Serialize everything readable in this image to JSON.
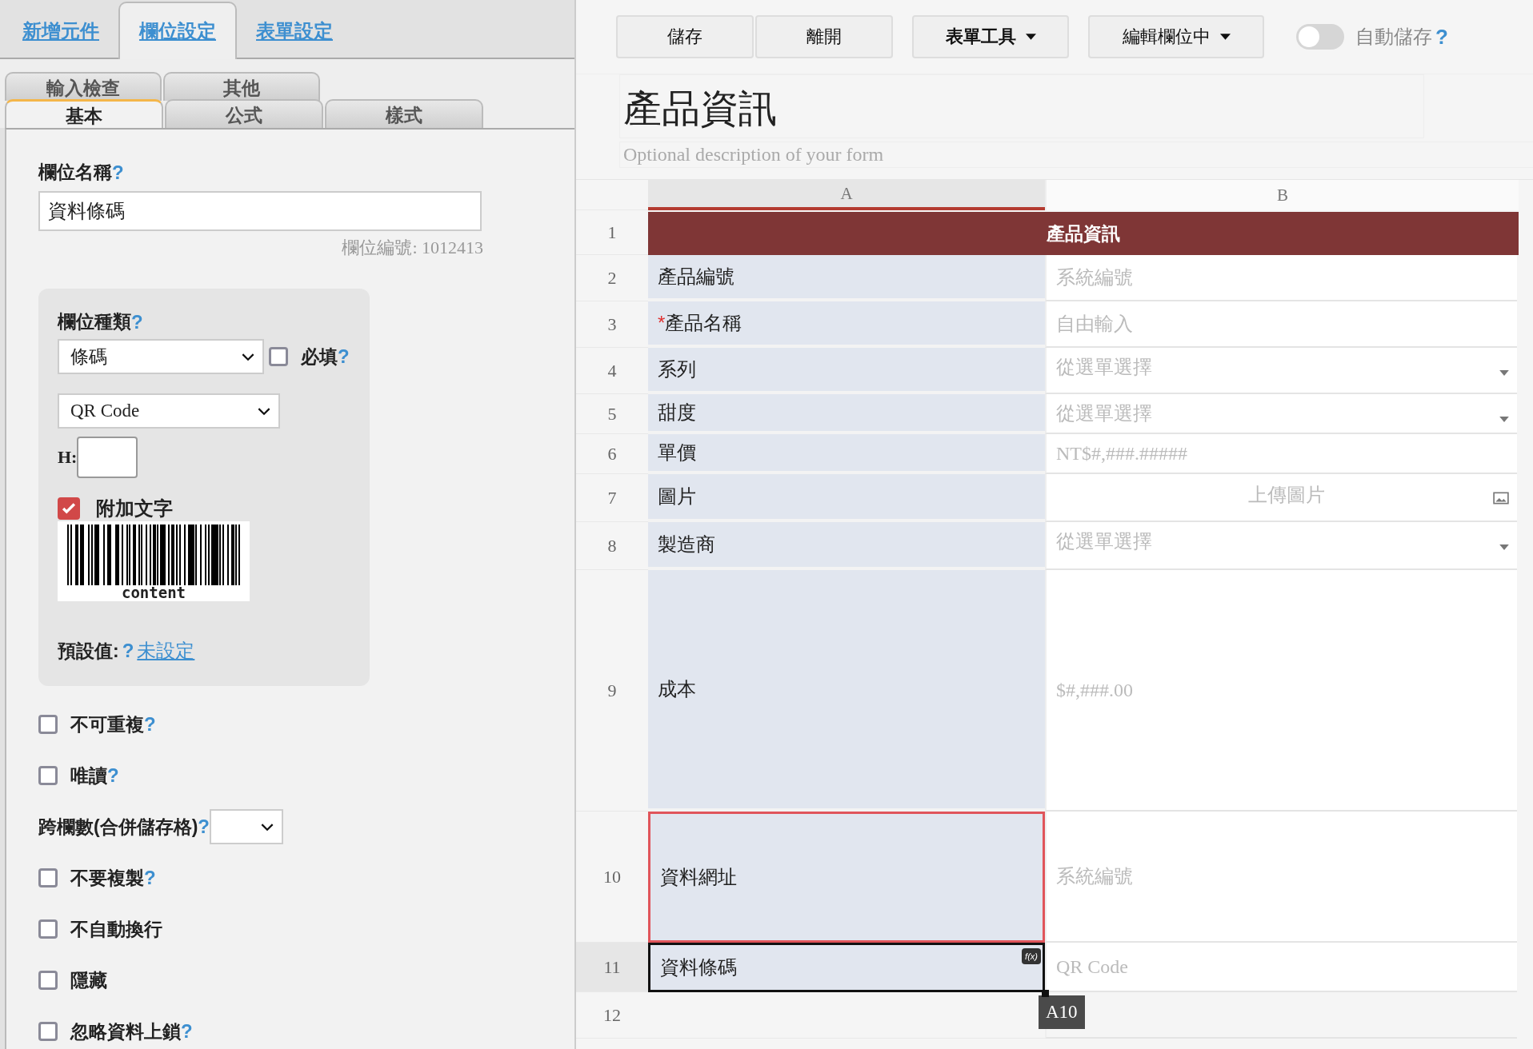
{
  "top_tabs": [
    {
      "label": "新增元件",
      "selected": false
    },
    {
      "label": "欄位設定",
      "selected": true
    },
    {
      "label": "表單設定",
      "selected": false
    }
  ],
  "sub_tabs": [
    [
      {
        "label": "輸入檢查",
        "selected": false
      },
      {
        "label": "其他",
        "selected": false
      }
    ],
    [
      {
        "label": "基本",
        "selected": true
      },
      {
        "label": "公式",
        "selected": false
      },
      {
        "label": "樣式",
        "selected": false
      }
    ]
  ],
  "field_name": {
    "label": "欄位名稱",
    "help": "?",
    "value": "資料條碼",
    "field_id": "欄位編號: 1012413"
  },
  "type_box": {
    "label": "欄位種類",
    "help": "?",
    "type_value": "條碼",
    "required": {
      "label": "必填",
      "help": "?",
      "checked": false
    },
    "subtype_value": "QR Code",
    "h_label": "H:",
    "add_text": {
      "label": "附加文字",
      "checked": true
    },
    "barcode_caption": "content",
    "default_label": "預設值:",
    "default_help": "?",
    "default_link": "未設定"
  },
  "options": [
    {
      "kind": "checkbox",
      "label": "不可重複",
      "help": "?",
      "checked": false
    },
    {
      "kind": "checkbox",
      "label": "唯讀",
      "help": "?",
      "checked": false
    },
    {
      "kind": "select",
      "label": "跨欄數(合併儲存格)",
      "help": "?"
    },
    {
      "kind": "checkbox",
      "label": "不要複製",
      "help": "?",
      "checked": false
    },
    {
      "kind": "checkbox",
      "label": "不自動換行",
      "checked": false
    },
    {
      "kind": "checkbox",
      "label": "隱藏",
      "checked": false
    },
    {
      "kind": "checkbox",
      "label": "忽略資料上鎖",
      "help": "?",
      "checked": false
    }
  ],
  "toolbar": {
    "buttons": [
      {
        "label": "儲存",
        "kind": "plain"
      },
      {
        "label": "離開",
        "kind": "plain"
      },
      {
        "label": "表單工具",
        "kind": "dropdown"
      },
      {
        "label": "編輯欄位中",
        "kind": "dropdown"
      }
    ],
    "autosave": {
      "label": "自動儲存",
      "help": "?",
      "on": false
    }
  },
  "form": {
    "title": "產品資訊",
    "description_placeholder": "Optional description of your form"
  },
  "grid": {
    "columns": [
      {
        "label": "A",
        "selected": true
      },
      {
        "label": "B",
        "selected": false
      }
    ],
    "rows": [
      {
        "num": "1",
        "kind": "header",
        "title": "產品資訊"
      },
      {
        "num": "2",
        "kind": "field",
        "label": "產品編號",
        "hint": {
          "text": "系統編號",
          "kind": "text"
        }
      },
      {
        "num": "3",
        "kind": "field",
        "label": "產品名稱",
        "required_mark": "*",
        "hint": {
          "text": "自由輸入",
          "kind": "text"
        }
      },
      {
        "num": "4",
        "kind": "field",
        "label": "系列",
        "hint": {
          "text": "從選單選擇",
          "kind": "select"
        }
      },
      {
        "num": "5",
        "kind": "field",
        "label": "甜度",
        "hint": {
          "text": "從選單選擇",
          "kind": "select"
        }
      },
      {
        "num": "6",
        "kind": "field",
        "label": "單價",
        "hint": {
          "text": "NT$#,###.#####",
          "kind": "text"
        }
      },
      {
        "num": "7",
        "kind": "field",
        "label": "圖片",
        "hint": {
          "text": "上傳圖片",
          "kind": "image"
        }
      },
      {
        "num": "8",
        "kind": "field",
        "label": "製造商",
        "hint": {
          "text": "從選單選擇",
          "kind": "select"
        }
      },
      {
        "num": "9",
        "kind": "field",
        "label": "成本",
        "hint": {
          "text": "$#,###.00",
          "kind": "text"
        }
      },
      {
        "num": "10",
        "kind": "field",
        "label": "資料網址",
        "hint": {
          "text": "系統編號",
          "kind": "text"
        },
        "flagged": true
      },
      {
        "num": "11",
        "kind": "field",
        "label": "資料條碼",
        "hint": {
          "text": "QR Code",
          "kind": "text"
        },
        "selected": true,
        "formula_badge": "f(x)",
        "cell_ref": "A10"
      },
      {
        "num": "12",
        "kind": "empty"
      }
    ]
  }
}
